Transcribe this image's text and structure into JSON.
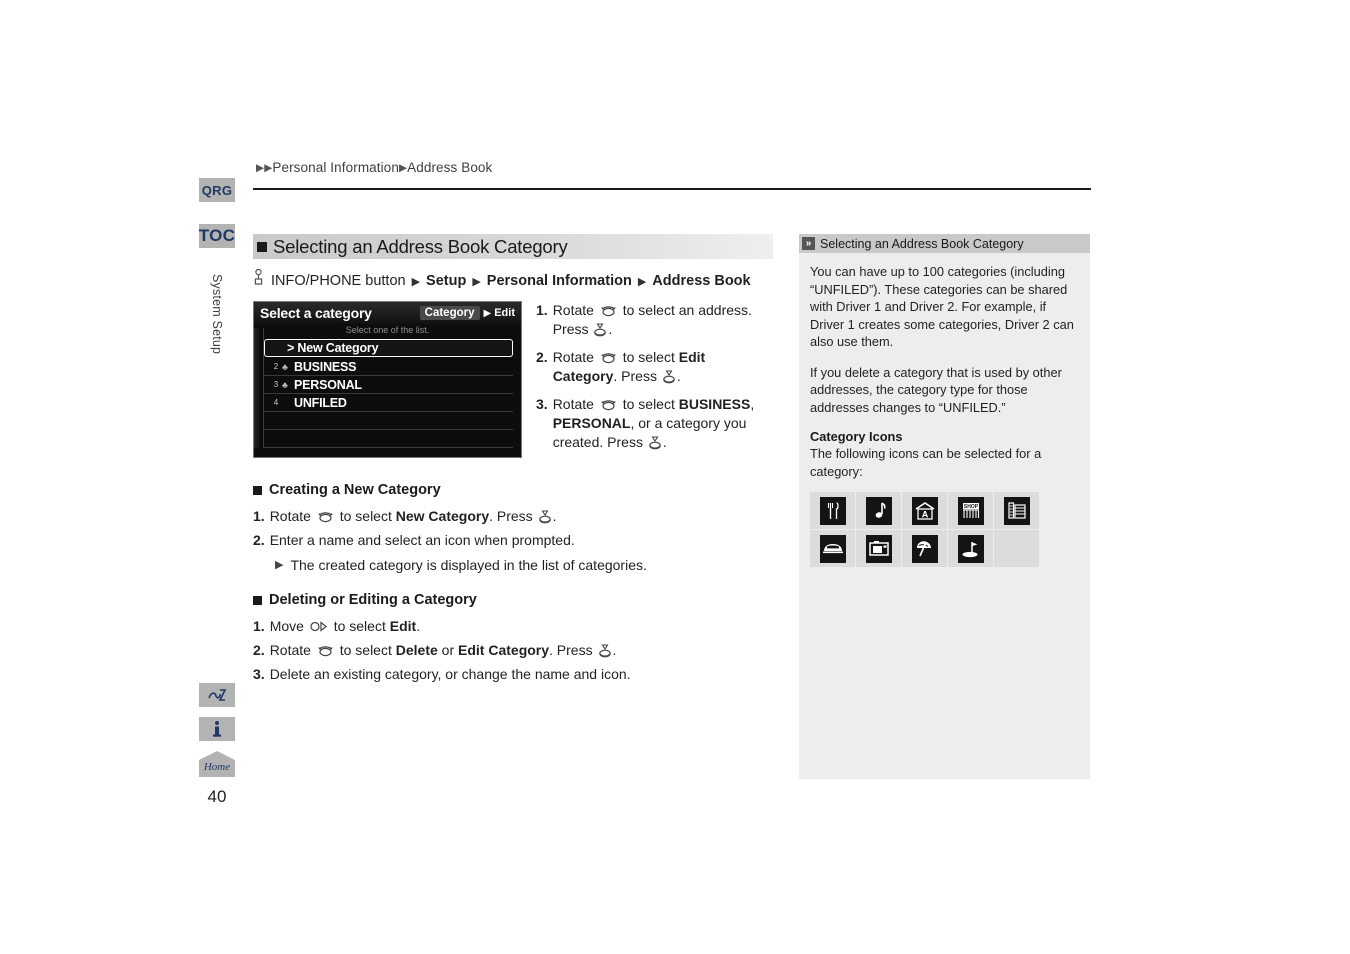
{
  "rail": {
    "qrg": "QRG",
    "toc": "TOC",
    "section": "System Setup",
    "home_label": "Home",
    "page_number": "40"
  },
  "header": {
    "breadcrumb_1": "Personal Information",
    "breadcrumb_2": "Address Book"
  },
  "main": {
    "section_title": "Selecting an Address Book Category",
    "path": {
      "button": "INFO/PHONE button",
      "s1": "Setup",
      "s2": "Personal Information",
      "s3": "Address Book"
    },
    "screenshot": {
      "title": "Select a category",
      "category_button": "Category",
      "edit_button": "Edit",
      "subtitle": "Select one of the list.",
      "rows": [
        {
          "num": "",
          "label": "> New Category",
          "selected": true
        },
        {
          "num": "2",
          "label": "BUSINESS",
          "selected": false
        },
        {
          "num": "3",
          "label": "PERSONAL",
          "selected": false
        },
        {
          "num": "4",
          "label": "UNFILED",
          "selected": false
        }
      ]
    },
    "steps": [
      {
        "n": "1.",
        "parts": [
          {
            "t": "Rotate ",
            "b": false
          },
          {
            "t": "@ROT@",
            "b": false
          },
          {
            "t": " to select an address. Press ",
            "b": false
          },
          {
            "t": "@PRESS@",
            "b": false
          },
          {
            "t": ".",
            "b": false
          }
        ]
      },
      {
        "n": "2.",
        "parts": [
          {
            "t": "Rotate ",
            "b": false
          },
          {
            "t": "@ROT@",
            "b": false
          },
          {
            "t": " to select ",
            "b": false
          },
          {
            "t": "Edit Category",
            "b": true
          },
          {
            "t": ". Press ",
            "b": false
          },
          {
            "t": "@PRESS@",
            "b": false
          },
          {
            "t": ".",
            "b": false
          }
        ]
      },
      {
        "n": "3.",
        "parts": [
          {
            "t": "Rotate ",
            "b": false
          },
          {
            "t": "@ROT@",
            "b": false
          },
          {
            "t": " to select ",
            "b": false
          },
          {
            "t": "BUSINESS",
            "b": true
          },
          {
            "t": ", ",
            "b": false
          },
          {
            "t": "PERSONAL",
            "b": true
          },
          {
            "t": ", or a category you created. Press ",
            "b": false
          },
          {
            "t": "@PRESS@",
            "b": false
          },
          {
            "t": ".",
            "b": false
          }
        ]
      }
    ],
    "creating": {
      "heading": "Creating a New Category",
      "steps": [
        {
          "n": "1.",
          "parts": [
            {
              "t": "Rotate ",
              "b": false
            },
            {
              "t": "@ROT@",
              "b": false
            },
            {
              "t": " to select ",
              "b": false
            },
            {
              "t": "New Category",
              "b": true
            },
            {
              "t": ". Press ",
              "b": false
            },
            {
              "t": "@PRESS@",
              "b": false
            },
            {
              "t": ".",
              "b": false
            }
          ]
        },
        {
          "n": "2.",
          "parts": [
            {
              "t": "Enter a name and select an icon when prompted.",
              "b": false
            }
          ]
        }
      ],
      "note": "The created category is displayed in the list of categories."
    },
    "deleting": {
      "heading": "Deleting or Editing a Category",
      "steps": [
        {
          "n": "1.",
          "parts": [
            {
              "t": "Move ",
              "b": false
            },
            {
              "t": "@MOVE@",
              "b": false
            },
            {
              "t": " to select ",
              "b": false
            },
            {
              "t": "Edit",
              "b": true
            },
            {
              "t": ".",
              "b": false
            }
          ]
        },
        {
          "n": "2.",
          "parts": [
            {
              "t": "Rotate ",
              "b": false
            },
            {
              "t": "@ROT@",
              "b": false
            },
            {
              "t": " to select ",
              "b": false
            },
            {
              "t": "Delete",
              "b": true
            },
            {
              "t": " or ",
              "b": false
            },
            {
              "t": "Edit Category",
              "b": true
            },
            {
              "t": ". Press ",
              "b": false
            },
            {
              "t": "@PRESS@",
              "b": false
            },
            {
              "t": ".",
              "b": false
            }
          ]
        },
        {
          "n": "3.",
          "parts": [
            {
              "t": "Delete an existing category, or change the name and icon.",
              "b": false
            }
          ]
        }
      ]
    }
  },
  "side": {
    "title": "Selecting an Address Book Category",
    "paragraphs": [
      "You can have up to 100 categories (including “UNFILED”). These categories can be shared with Driver 1 and Driver 2. For example, if Driver 1 creates some categories, Driver 2 can also use them.",
      "If you delete a category that is used by other addresses, the category type for those addresses changes to “UNFILED.”"
    ],
    "icons_heading": "Category Icons",
    "icons_intro": "The following icons can be selected for a category:",
    "icons": [
      {
        "name": "restaurant-icon"
      },
      {
        "name": "music-note-icon"
      },
      {
        "name": "school-icon"
      },
      {
        "name": "shop-icon"
      },
      {
        "name": "office-building-icon"
      },
      {
        "name": "car-icon"
      },
      {
        "name": "photo-icon"
      },
      {
        "name": "beach-umbrella-icon"
      },
      {
        "name": "golf-flag-icon"
      },
      {
        "name": "empty-slot"
      }
    ]
  },
  "colors": {
    "accent_blue": "#1f3864",
    "tab_gray": "#b3b3b3",
    "panel_gray": "#ededed",
    "heading_gray": "#c9c9c9"
  }
}
